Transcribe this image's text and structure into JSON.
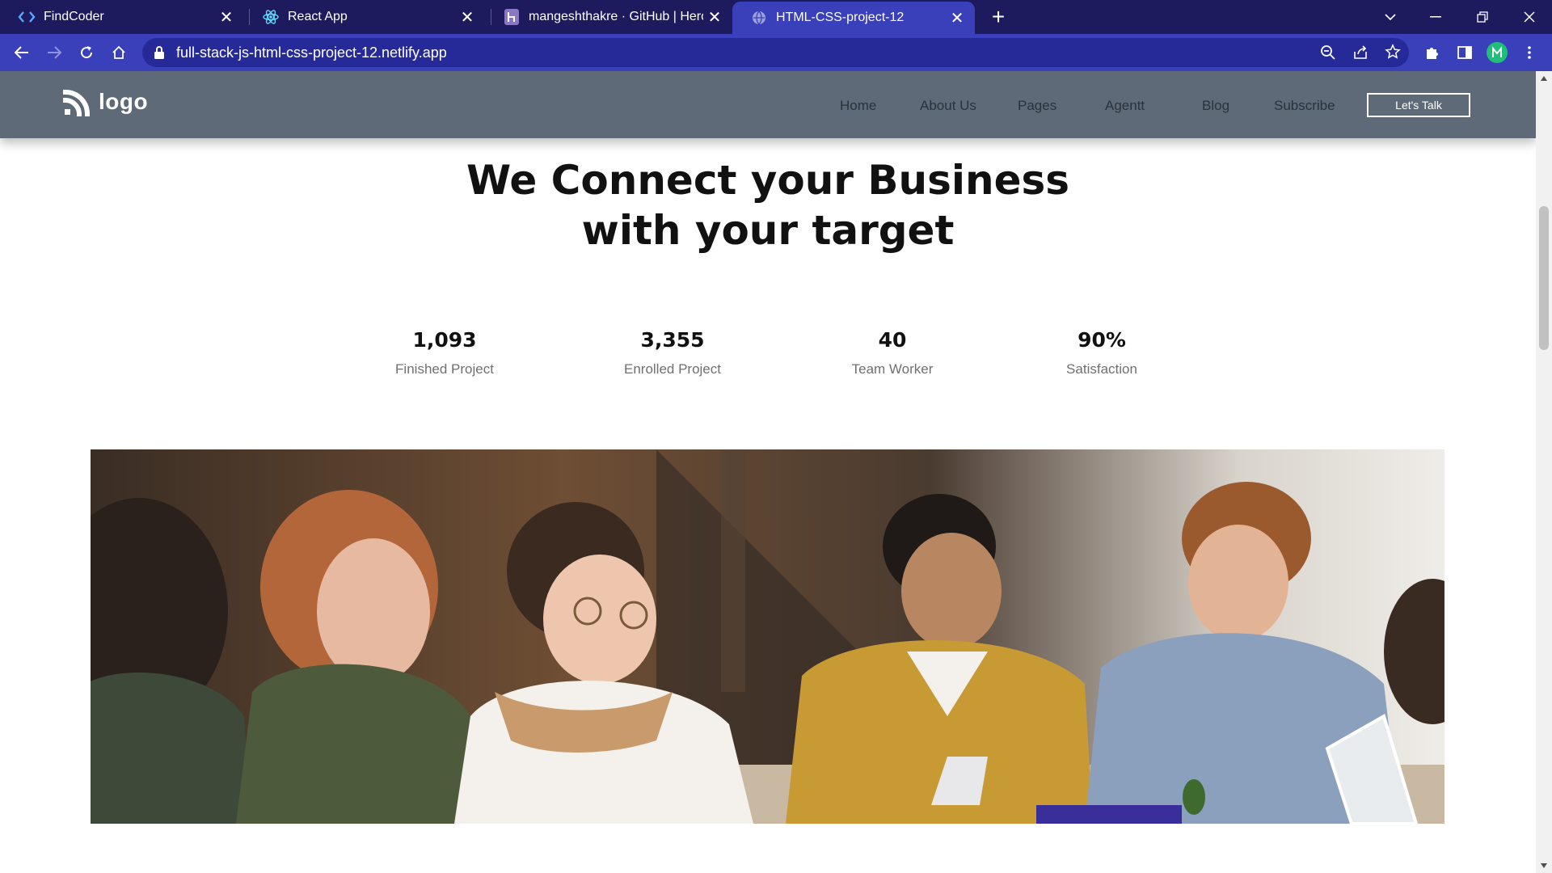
{
  "browser": {
    "tabs": [
      {
        "title": "FindCoder",
        "icon": "code-brackets-icon"
      },
      {
        "title": "React App",
        "icon": "react-atom-icon"
      },
      {
        "title": "mangeshthakre · GitHub | Heroku",
        "icon": "heroku-icon"
      },
      {
        "title": "HTML-CSS-project-12",
        "icon": "globe-icon",
        "active": true
      }
    ],
    "url": "full-stack-js-html-css-project-12.netlify.app",
    "profile_initial": "M",
    "colors": {
      "tabbar": "#1d1b5e",
      "toolbar": "#3a3fba",
      "profile": "#1fbf7a"
    }
  },
  "page": {
    "logo_text": "logo",
    "nav": [
      "Home",
      "About Us",
      "Pages",
      "Agentt",
      "Blog",
      "Subscribe"
    ],
    "cta_label": "Let's Talk",
    "headline_line1": "We Connect your Business",
    "headline_line2": "with your target",
    "stats": [
      {
        "value": "1,093",
        "label": "Finished Project"
      },
      {
        "value": "3,355",
        "label": "Enrolled Project"
      },
      {
        "value": "40",
        "label": "Team Worker"
      },
      {
        "value": "90%",
        "label": "Satisfaction"
      }
    ],
    "colors": {
      "navbar": "#5f6a78",
      "nav_text": "#2a323d"
    }
  }
}
